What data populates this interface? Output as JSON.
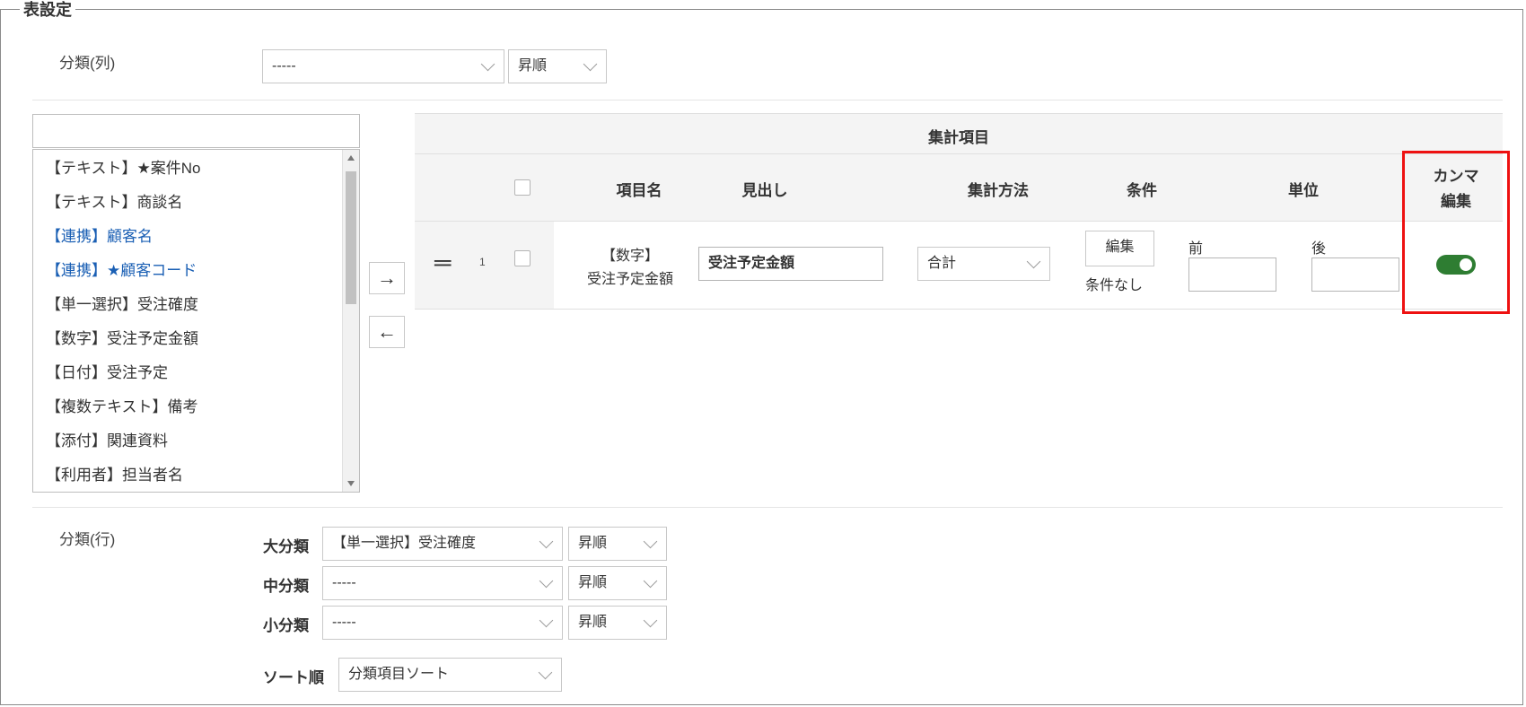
{
  "panel": {
    "title": "表設定"
  },
  "column_category": {
    "label": "分類(列)",
    "select_value": "-----",
    "order_value": "昇順"
  },
  "field_list": {
    "search_value": "",
    "items": [
      {
        "label": "【テキスト】★案件No",
        "linked": false
      },
      {
        "label": "【テキスト】商談名",
        "linked": false
      },
      {
        "label": "【連携】顧客名",
        "linked": true
      },
      {
        "label": "【連携】★顧客コード",
        "linked": true
      },
      {
        "label": "【単一選択】受注確度",
        "linked": false
      },
      {
        "label": "【数字】受注予定金額",
        "linked": false
      },
      {
        "label": "【日付】受注予定",
        "linked": false
      },
      {
        "label": "【複数テキスト】備考",
        "linked": false
      },
      {
        "label": "【添付】関連資料",
        "linked": false
      },
      {
        "label": "【利用者】担当者名",
        "linked": false
      }
    ],
    "colors": {
      "linked": "#1a5fb4",
      "normal": "#333333"
    }
  },
  "transfer": {
    "add_icon": "arrow-right-icon",
    "add_glyph": "→",
    "remove_icon": "arrow-left-icon",
    "remove_glyph": "←"
  },
  "aggregate_table": {
    "title": "集計項目",
    "headers": {
      "item_name": "項目名",
      "heading": "見出し",
      "method": "集計方法",
      "condition": "条件",
      "unit": "単位",
      "comma_line1": "カンマ",
      "comma_line2": "編集"
    },
    "rows": [
      {
        "handle_glyph": "═",
        "index": "1",
        "item_line1": "【数字】",
        "item_line2": "受注予定金額",
        "heading_value": "受注予定金額",
        "method_value": "合計",
        "edit_button": "編集",
        "condition_status": "条件なし",
        "unit_before_label": "前",
        "unit_before_value": "",
        "unit_after_label": "後",
        "unit_after_value": "",
        "comma_enabled": true
      }
    ],
    "highlight_color": "#ee1111",
    "toggle_color": "#2e7d32"
  },
  "row_category": {
    "label": "分類(行)",
    "large": {
      "label": "大分類",
      "value": "【単一選択】受注確度",
      "order": "昇順"
    },
    "medium": {
      "label": "中分類",
      "value": "-----",
      "order": "昇順"
    },
    "small": {
      "label": "小分類",
      "value": "-----",
      "order": "昇順"
    },
    "sort": {
      "label": "ソート順",
      "value": "分類項目ソート"
    }
  }
}
